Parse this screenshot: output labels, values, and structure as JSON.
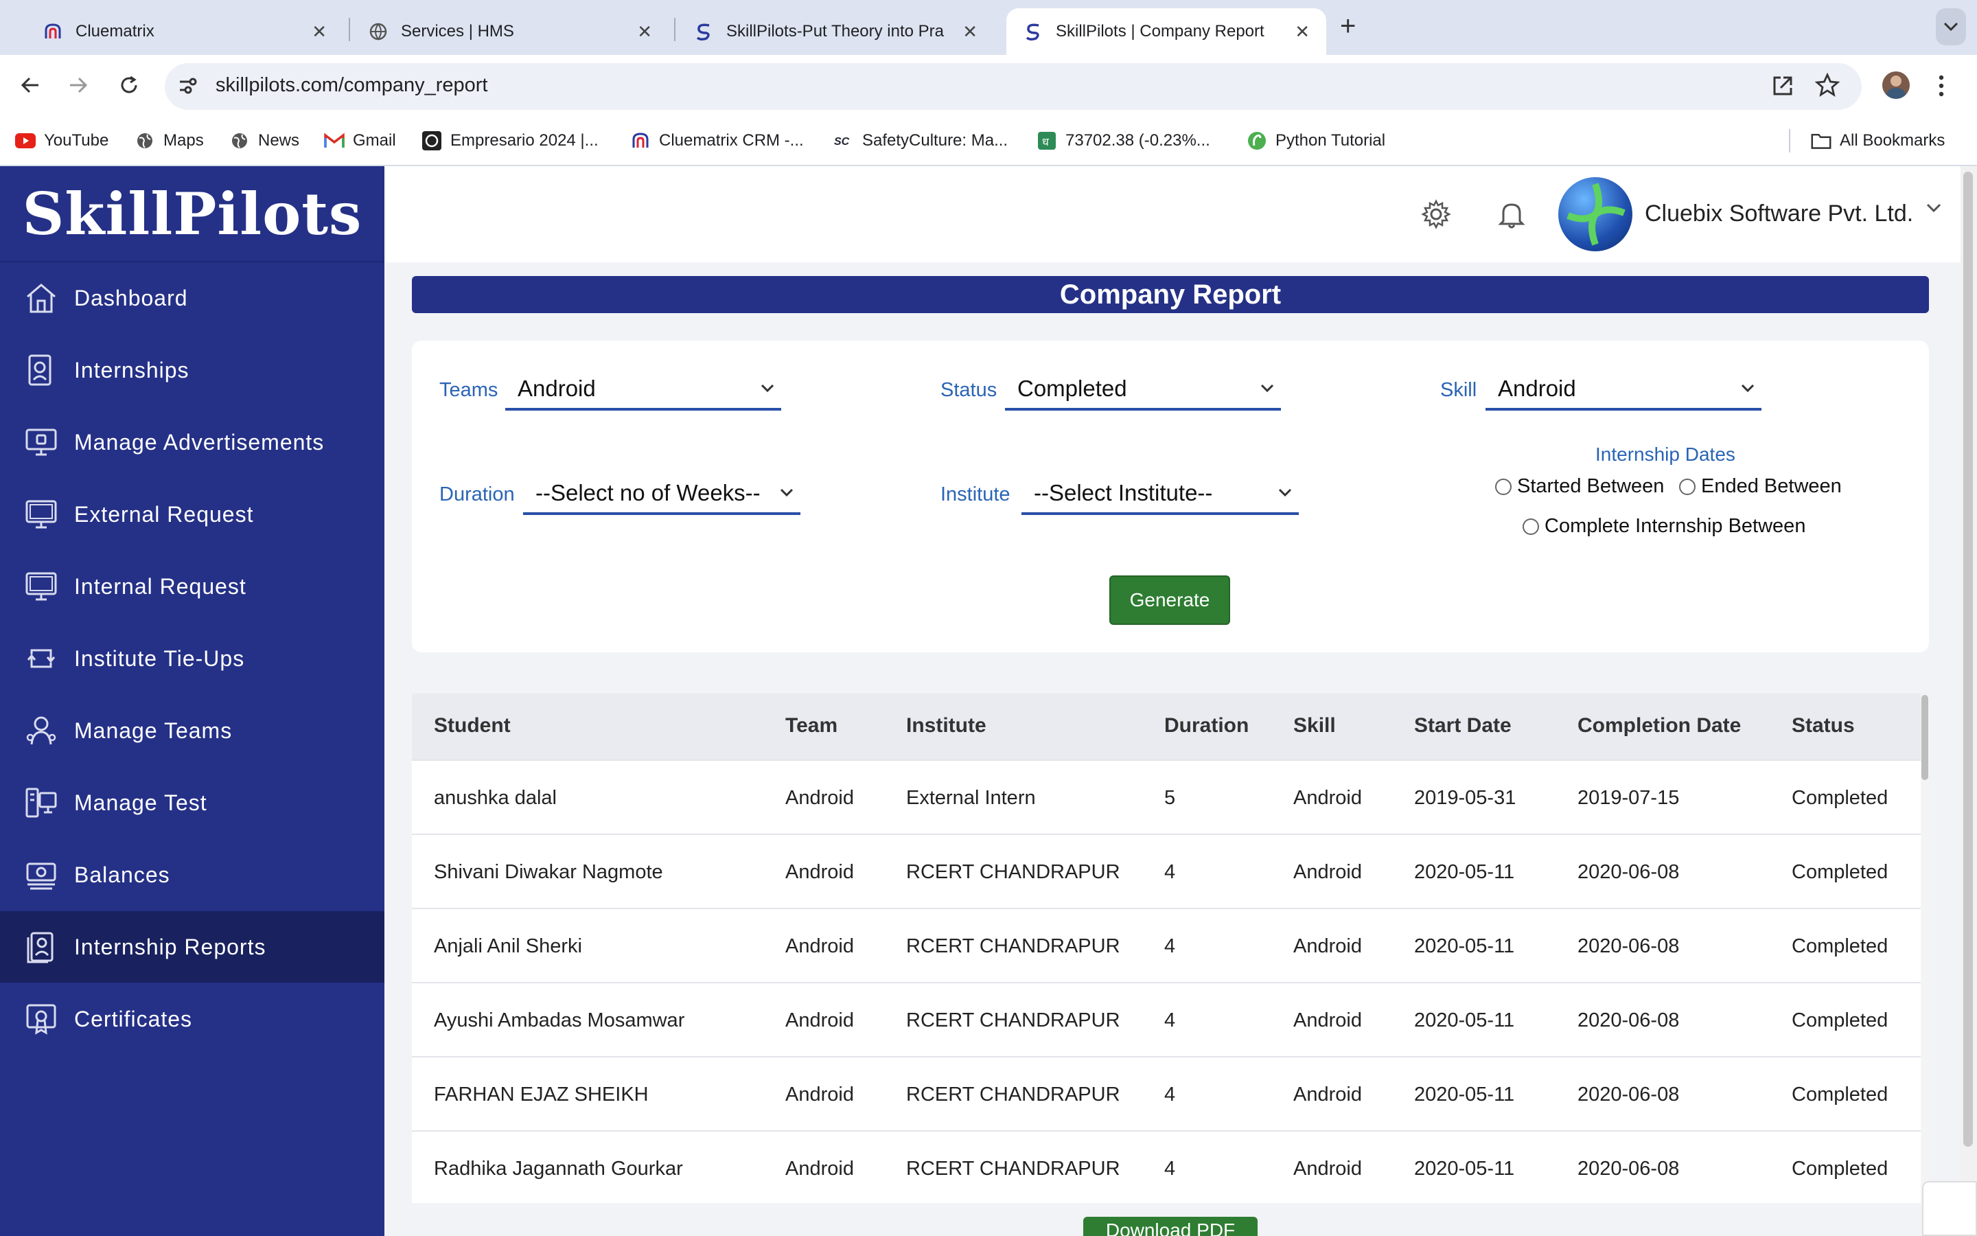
{
  "browser": {
    "tabs": [
      {
        "title": "Cluematrix",
        "icon": "cluematrix-icon",
        "active": false
      },
      {
        "title": "Services | HMS",
        "icon": "globe-icon",
        "active": false
      },
      {
        "title": "SkillPilots-Put Theory into Pra",
        "icon": "skillpilots-icon",
        "active": false
      },
      {
        "title": "SkillPilots | Company Report",
        "icon": "skillpilots-icon",
        "active": true
      }
    ],
    "new_tab": "+",
    "url": "skillpilots.com/company_report",
    "bookmarks": [
      {
        "label": "YouTube",
        "icon": "youtube-icon"
      },
      {
        "label": "Maps",
        "icon": "globe-icon"
      },
      {
        "label": "News",
        "icon": "globe-icon"
      },
      {
        "label": "Gmail",
        "icon": "gmail-icon"
      },
      {
        "label": "Empresario 2024 |...",
        "icon": "empresario-icon"
      },
      {
        "label": "Cluematrix CRM -...",
        "icon": "cluematrix-icon"
      },
      {
        "label": "SafetyCulture: Ma...",
        "icon": "safetyculture-icon"
      },
      {
        "label": "73702.38 (-0.23%...",
        "icon": "stock-icon"
      },
      {
        "label": "Python Tutorial",
        "icon": "python-icon"
      }
    ],
    "all_bookmarks": "All Bookmarks"
  },
  "sidebar": {
    "logo": "SkillPilots",
    "items": [
      {
        "label": "Dashboard",
        "icon": "home-icon"
      },
      {
        "label": "Internships",
        "icon": "internship-icon"
      },
      {
        "label": "Manage Advertisements",
        "icon": "advertisement-icon"
      },
      {
        "label": "External Request",
        "icon": "monitor-icon"
      },
      {
        "label": "Internal Request",
        "icon": "monitor-icon"
      },
      {
        "label": "Institute Tie-Ups",
        "icon": "tieup-icon"
      },
      {
        "label": "Manage Teams",
        "icon": "teams-icon"
      },
      {
        "label": "Manage Test",
        "icon": "test-icon"
      },
      {
        "label": "Balances",
        "icon": "balance-icon"
      },
      {
        "label": "Internship Reports",
        "icon": "report-icon"
      },
      {
        "label": "Certificates",
        "icon": "certificate-icon"
      }
    ],
    "active": "Internship Reports"
  },
  "header": {
    "company": "Cluebix Software Pvt. Ltd."
  },
  "page": {
    "title": "Company Report",
    "filters": {
      "teams_label": "Teams",
      "teams_value": "Android",
      "status_label": "Status",
      "status_value": "Completed",
      "skill_label": "Skill",
      "skill_value": "Android",
      "duration_label": "Duration",
      "duration_value": "--Select no of Weeks--",
      "institute_label": "Institute",
      "institute_value": "--Select Institute--",
      "dates_title": "Internship Dates",
      "radio_started": "Started Between",
      "radio_ended": "Ended Between",
      "radio_complete": "Complete Internship Between"
    },
    "generate": "Generate",
    "download_pdf": "Download PDF"
  },
  "table": {
    "columns": [
      "Student",
      "Team",
      "Institute",
      "Duration",
      "Skill",
      "Start Date",
      "Completion Date",
      "Status"
    ],
    "rows": [
      [
        "anushka dalal",
        "Android",
        "External Intern",
        "5",
        "Android",
        "2019-05-31",
        "2019-07-15",
        "Completed"
      ],
      [
        "Shivani Diwakar Nagmote",
        "Android",
        "RCERT CHANDRAPUR",
        "4",
        "Android",
        "2020-05-11",
        "2020-06-08",
        "Completed"
      ],
      [
        "Anjali Anil Sherki",
        "Android",
        "RCERT CHANDRAPUR",
        "4",
        "Android",
        "2020-05-11",
        "2020-06-08",
        "Completed"
      ],
      [
        "Ayushi Ambadas Mosamwar",
        "Android",
        "RCERT CHANDRAPUR",
        "4",
        "Android",
        "2020-05-11",
        "2020-06-08",
        "Completed"
      ],
      [
        "FARHAN EJAZ SHEIKH",
        "Android",
        "RCERT CHANDRAPUR",
        "4",
        "Android",
        "2020-05-11",
        "2020-06-08",
        "Completed"
      ],
      [
        "Radhika Jagannath Gourkar",
        "Android",
        "RCERT CHANDRAPUR",
        "4",
        "Android",
        "2020-05-11",
        "2020-06-08",
        "Completed"
      ]
    ]
  },
  "colors": {
    "sidebar": "#253187",
    "sidebar_active": "#19215f",
    "label_blue": "#2a64b5",
    "generate_green": "#2e7d32"
  }
}
